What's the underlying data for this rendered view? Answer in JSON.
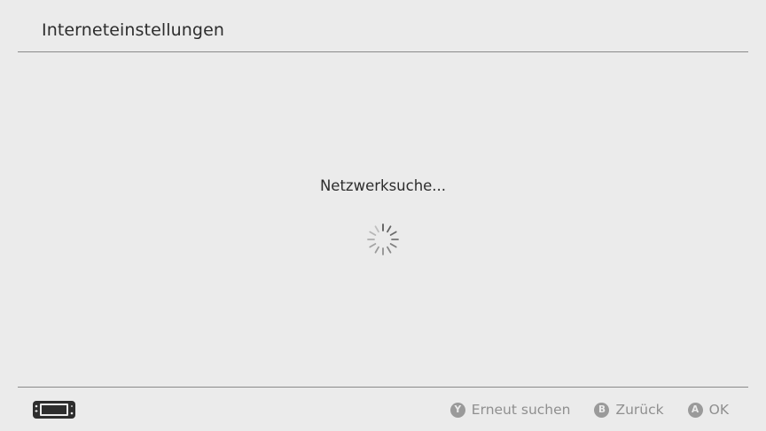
{
  "header": {
    "title": "Interneteinstellungen"
  },
  "main": {
    "status": "Netzwerksuche...",
    "spinner_icon": "loading-spinner-icon"
  },
  "footer": {
    "device_icon": "handheld-console-icon",
    "buttons": [
      {
        "glyph": "Y",
        "label": "Erneut suchen"
      },
      {
        "glyph": "B",
        "label": "Zurück"
      },
      {
        "glyph": "A",
        "label": "OK"
      }
    ]
  },
  "colors": {
    "background": "#ebebeb",
    "text": "#2d2d2d",
    "divider": "#8a8a8a",
    "hint_text": "#8f8f8f"
  }
}
